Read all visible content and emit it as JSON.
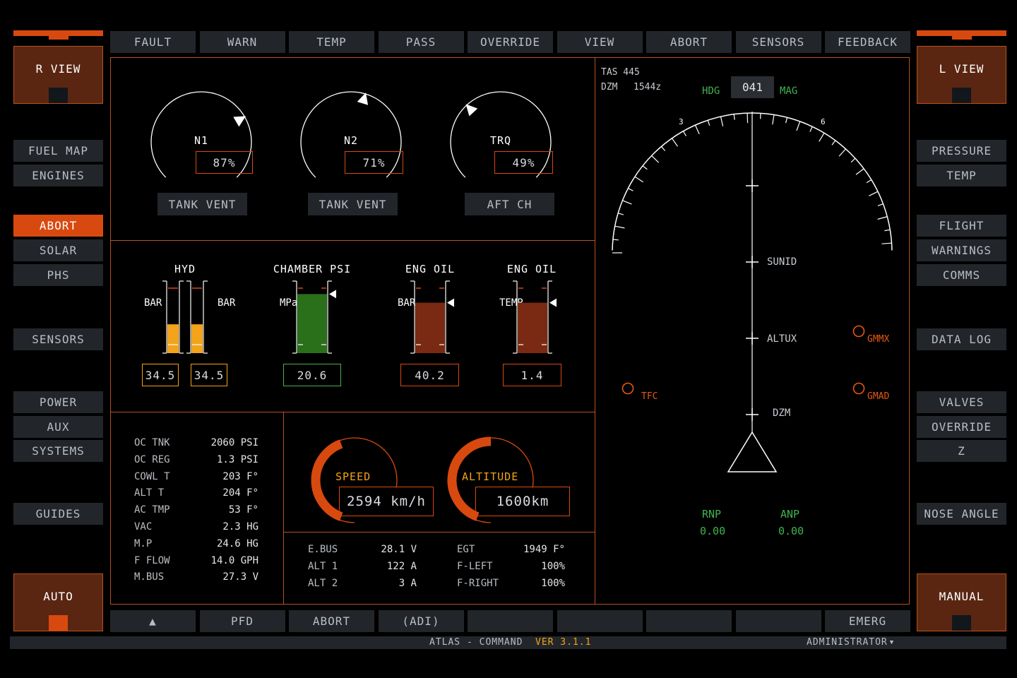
{
  "top_tabs": [
    "FAULT",
    "WARN",
    "TEMP",
    "PASS",
    "OVERRIDE",
    "VIEW",
    "ABORT",
    "SENSORS",
    "FEEDBACK"
  ],
  "bottom_tabs": [
    "▲",
    "PFD",
    "ABORT",
    "(ADI)",
    "",
    "",
    "",
    "",
    "EMERG"
  ],
  "left_view": "R VIEW",
  "right_view": "L VIEW",
  "left_auto": "AUTO",
  "right_manual": "MANUAL",
  "left_menu": {
    "fuel_map": "FUEL MAP",
    "engines": "ENGINES",
    "abort": "ABORT",
    "solar": "SOLAR",
    "phs": "PHS",
    "sensors": "SENSORS",
    "power": "POWER",
    "aux": "AUX",
    "systems": "SYSTEMS",
    "guides": "GUIDES"
  },
  "right_menu": {
    "pressure": "PRESSURE",
    "temp": "TEMP",
    "flight": "FLIGHT",
    "warnings": "WARNINGS",
    "comms": "COMMS",
    "data_log": "DATA LOG",
    "valves": "VALVES",
    "override": "OVERRIDE",
    "z": "Z",
    "nose_angle": "NOSE ANGLE"
  },
  "dials": [
    {
      "label": "N1",
      "value": "87%",
      "button": "TANK VENT",
      "pct": 87
    },
    {
      "label": "N2",
      "value": "71%",
      "button": "TANK VENT",
      "pct": 71
    },
    {
      "label": "TRQ",
      "value": "49%",
      "button": "AFT CH",
      "pct": 49
    }
  ],
  "bar_gauges": {
    "hyd": {
      "title": "HYD",
      "axis1": "BAR",
      "axis2": "BAR",
      "value1": "34.5",
      "value2": "34.5",
      "level1": 0.4,
      "level2": 0.4
    },
    "chamber": {
      "title": "CHAMBER PSI",
      "axis": "MPa",
      "value": "20.6",
      "level": 0.82
    },
    "eng_oil_1": {
      "title": "ENG OIL",
      "axis": "BAR",
      "value": "40.2",
      "level": 0.7
    },
    "eng_oil_2": {
      "title": "ENG OIL",
      "axis": "TEMP",
      "value": "1.4",
      "level": 0.7
    }
  },
  "readings_left": [
    {
      "k": "OC TNK",
      "v": "2060 PSI"
    },
    {
      "k": "OC REG",
      "v": "1.3 PSI"
    },
    {
      "k": "COWL T",
      "v": "203 F°"
    },
    {
      "k": "ALT T",
      "v": "204 F°"
    },
    {
      "k": "AC TMP",
      "v": "53 F°"
    },
    {
      "k": "VAC",
      "v": "2.3 HG"
    },
    {
      "k": "M.P",
      "v": "24.6 HG"
    },
    {
      "k": "F FLOW",
      "v": "14.0 GPH"
    },
    {
      "k": "M.BUS",
      "v": "27.3 V"
    }
  ],
  "speed": {
    "label": "SPEED",
    "value": "2594 km/h",
    "fraction": 0.62
  },
  "altitude": {
    "label": "ALTITUDE",
    "value": "1600km",
    "fraction": 0.5
  },
  "readings_bottom": [
    {
      "k": "E.BUS",
      "v": "28.1 V",
      "k2": "EGT",
      "v2": "1949 F°"
    },
    {
      "k": "ALT 1",
      "v": "122 A",
      "k2": "F-LEFT",
      "v2": "100%"
    },
    {
      "k": "ALT 2",
      "v": "3 A",
      "k2": "F-RIGHT",
      "v2": "100%"
    }
  ],
  "nav": {
    "tas": "TAS 445",
    "dzm": "DZM",
    "time": "1544z",
    "hdg": "HDG",
    "heading": "041",
    "mag": "MAG",
    "scale_left": "3",
    "scale_right": "6",
    "waypoints": [
      "SUNID",
      "ALTUX",
      "DZM"
    ],
    "tfc": "TFC",
    "gmmx": "GMMX",
    "gmad": "GMAD",
    "rnp": "RNP",
    "rnp_val": "0.00",
    "anp": "ANP",
    "anp_val": "0.00"
  },
  "status": {
    "app": "ATLAS - COMMAND",
    "version": "VER 3.1.1",
    "user": "ADMINISTRATOR"
  },
  "colors": {
    "accent": "#d8490f",
    "panel_border": "#b5521c",
    "green": "#3fb34f",
    "amber": "#f2a31a"
  }
}
